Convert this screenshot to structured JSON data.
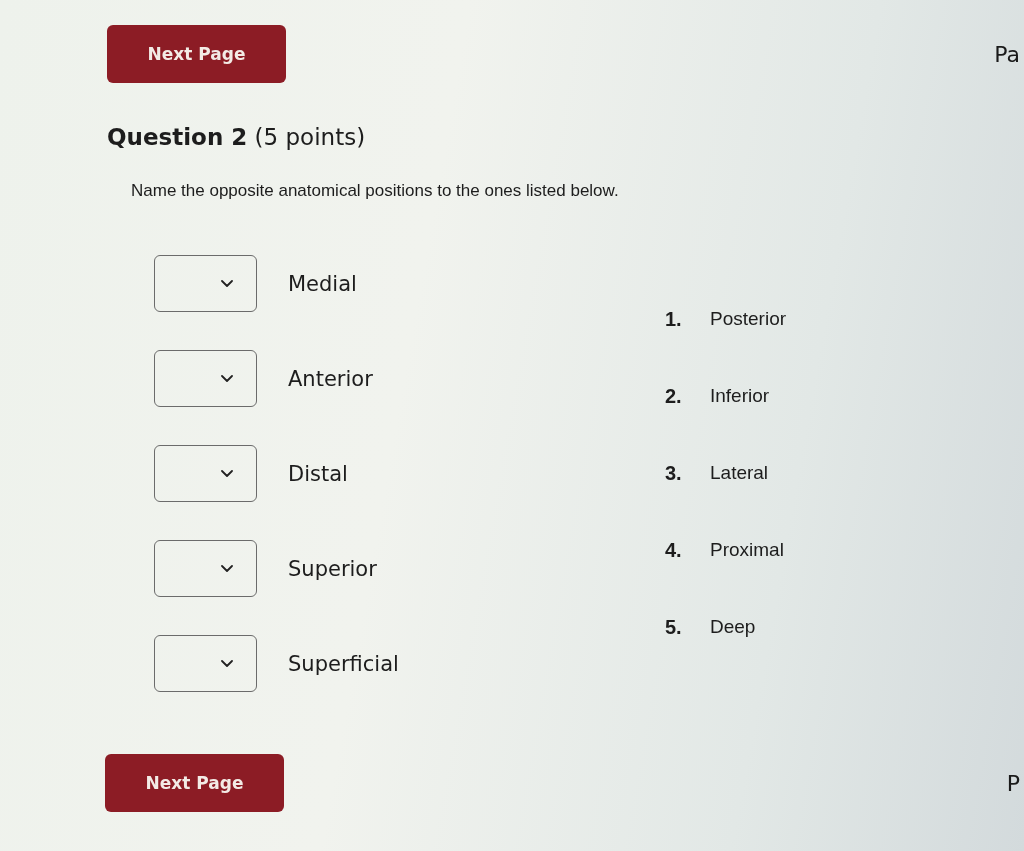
{
  "header": {
    "button": "Next Page",
    "page_label": "Pa"
  },
  "question": {
    "title": "**Question 2** (5 points)",
    "instruction": "Name the opposite anatomical positions to the ones listed below."
  },
  "matches": [
    {
      "term": "Medial"
    },
    {
      "term": "Anterior"
    },
    {
      "term": "Distal"
    },
    {
      "term": "Superior"
    },
    {
      "term": "Superficial"
    }
  ],
  "options": [
    {
      "number": "1.",
      "text": "Posterior"
    },
    {
      "number": "2.",
      "text": "Inferior"
    },
    {
      "number": "3.",
      "text": "Lateral"
    },
    {
      "number": "4.",
      "text": "Proximal"
    },
    {
      "number": "5.",
      "text": "Deep"
    }
  ],
  "footer": {
    "button": "Next Page",
    "page_label": "P"
  }
}
